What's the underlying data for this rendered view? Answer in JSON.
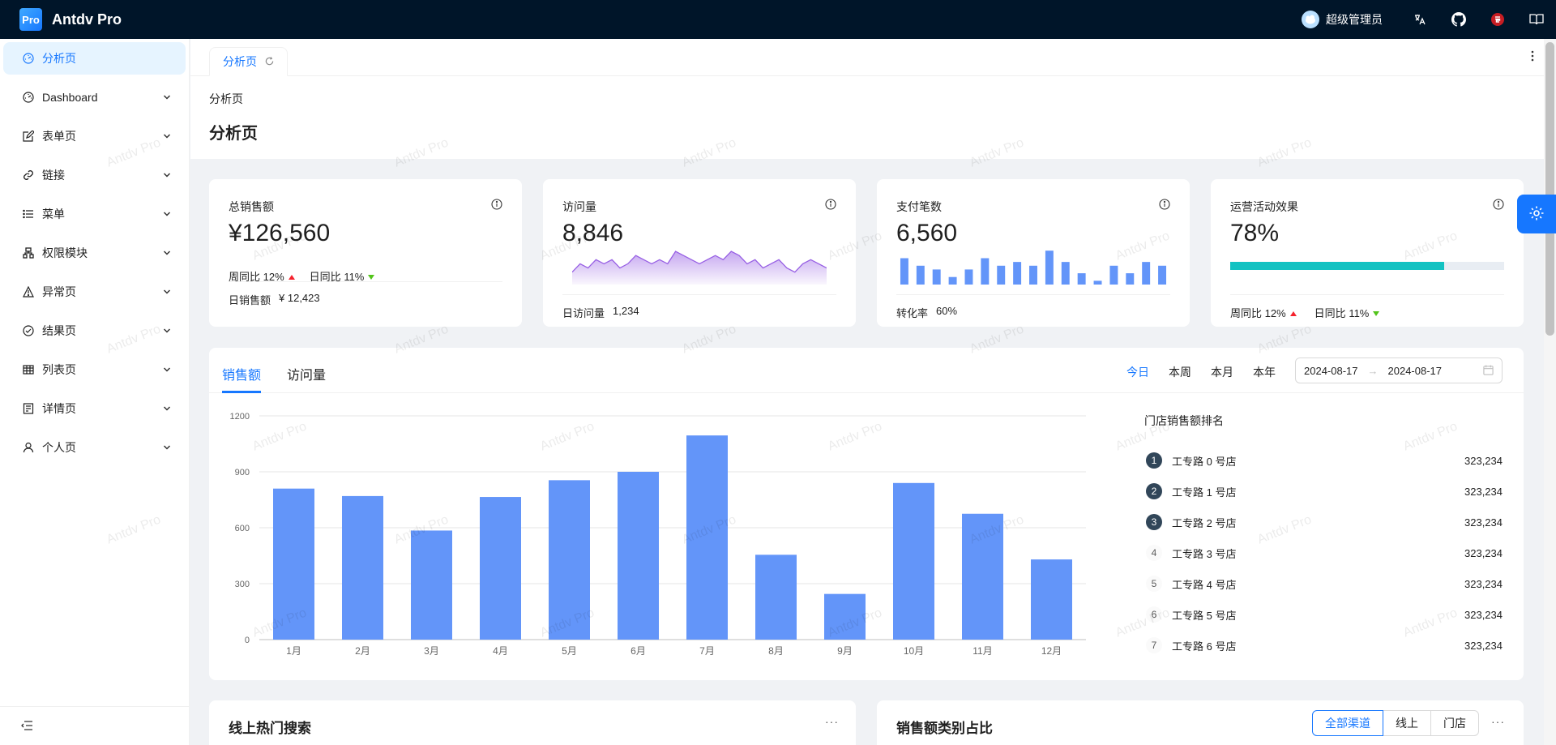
{
  "header": {
    "logo_text": "Pro",
    "app_title": "Antdv Pro",
    "user_name": "超级管理员",
    "icons": [
      "avatar-icon",
      "translate-icon",
      "github-icon",
      "gitee-icon",
      "docs-icon"
    ]
  },
  "sidebar": {
    "items": [
      {
        "label": "分析页",
        "icon": "dashboard-icon",
        "active": true
      },
      {
        "label": "Dashboard",
        "icon": "dashboard-icon"
      },
      {
        "label": "表单页",
        "icon": "form-icon"
      },
      {
        "label": "链接",
        "icon": "link-icon"
      },
      {
        "label": "菜单",
        "icon": "list-icon"
      },
      {
        "label": "权限模块",
        "icon": "cluster-icon"
      },
      {
        "label": "异常页",
        "icon": "warning-icon"
      },
      {
        "label": "结果页",
        "icon": "check-circle-icon"
      },
      {
        "label": "列表页",
        "icon": "table-icon"
      },
      {
        "label": "详情页",
        "icon": "profile-icon"
      },
      {
        "label": "个人页",
        "icon": "user-icon"
      }
    ]
  },
  "tabs": [
    {
      "label": "分析页"
    }
  ],
  "breadcrumb": "分析页",
  "page_title": "分析页",
  "watermark": "Antdv Pro",
  "stats": {
    "sales": {
      "title": "总销售额",
      "value": "¥126,560",
      "week_label": "周同比",
      "week_value": "12%",
      "day_label": "日同比",
      "day_value": "11%",
      "foot_label": "日销售额",
      "foot_value": "¥ 12,423"
    },
    "visits": {
      "title": "访问量",
      "value": "8,846",
      "foot_label": "日访问量",
      "foot_value": "1,234",
      "trend": [
        3,
        5,
        4,
        6,
        5,
        6,
        4,
        5,
        7,
        6,
        5,
        6,
        5,
        8,
        7,
        6,
        5,
        6,
        7,
        6,
        8,
        7,
        5,
        6,
        4,
        5,
        6,
        4,
        3,
        5,
        6,
        5,
        4
      ]
    },
    "payments": {
      "title": "支付笔数",
      "value": "6,560",
      "foot_label": "转化率",
      "foot_value": "60%",
      "bars": [
        7,
        5,
        4,
        2,
        4,
        7,
        5,
        6,
        5,
        9,
        6,
        3,
        1,
        5,
        3,
        6,
        5
      ]
    },
    "operations": {
      "title": "运营活动效果",
      "value": "78%",
      "progress": 0.78,
      "week_label": "周同比",
      "week_value": "12%",
      "day_label": "日同比",
      "day_value": "11%"
    }
  },
  "sales_card": {
    "tabs": [
      "销售额",
      "访问量"
    ],
    "ranges": [
      "今日",
      "本周",
      "本月",
      "本年"
    ],
    "date_start": "2024-08-17",
    "date_end": "2024-08-17",
    "rank_title": "门店销售额排名",
    "rank": [
      {
        "n": "1",
        "name": "工专路 0 号店",
        "value": "323,234"
      },
      {
        "n": "2",
        "name": "工专路 1 号店",
        "value": "323,234"
      },
      {
        "n": "3",
        "name": "工专路 2 号店",
        "value": "323,234"
      },
      {
        "n": "4",
        "name": "工专路 3 号店",
        "value": "323,234"
      },
      {
        "n": "5",
        "name": "工专路 4 号店",
        "value": "323,234"
      },
      {
        "n": "6",
        "name": "工专路 5 号店",
        "value": "323,234"
      },
      {
        "n": "7",
        "name": "工专路 6 号店",
        "value": "323,234"
      }
    ]
  },
  "chart_data": {
    "type": "bar",
    "categories": [
      "1月",
      "2月",
      "3月",
      "4月",
      "5月",
      "6月",
      "7月",
      "8月",
      "9月",
      "10月",
      "11月",
      "12月"
    ],
    "values": [
      810,
      770,
      585,
      765,
      855,
      900,
      1095,
      455,
      245,
      840,
      675,
      430
    ],
    "ylim": [
      0,
      1200
    ],
    "yticks": [
      0,
      300,
      600,
      900,
      1200
    ],
    "color": "#6395f9",
    "grid": true
  },
  "bottom": {
    "hot_search_title": "线上热门搜索",
    "category_title": "销售额类别占比",
    "channels": [
      "全部渠道",
      "线上",
      "门店"
    ],
    "more": "···"
  },
  "colors": {
    "primary": "#1677ff",
    "header_bg": "#001529",
    "progress": "#13c2c2",
    "bar": "#6395f9",
    "area": "#975fe4"
  }
}
